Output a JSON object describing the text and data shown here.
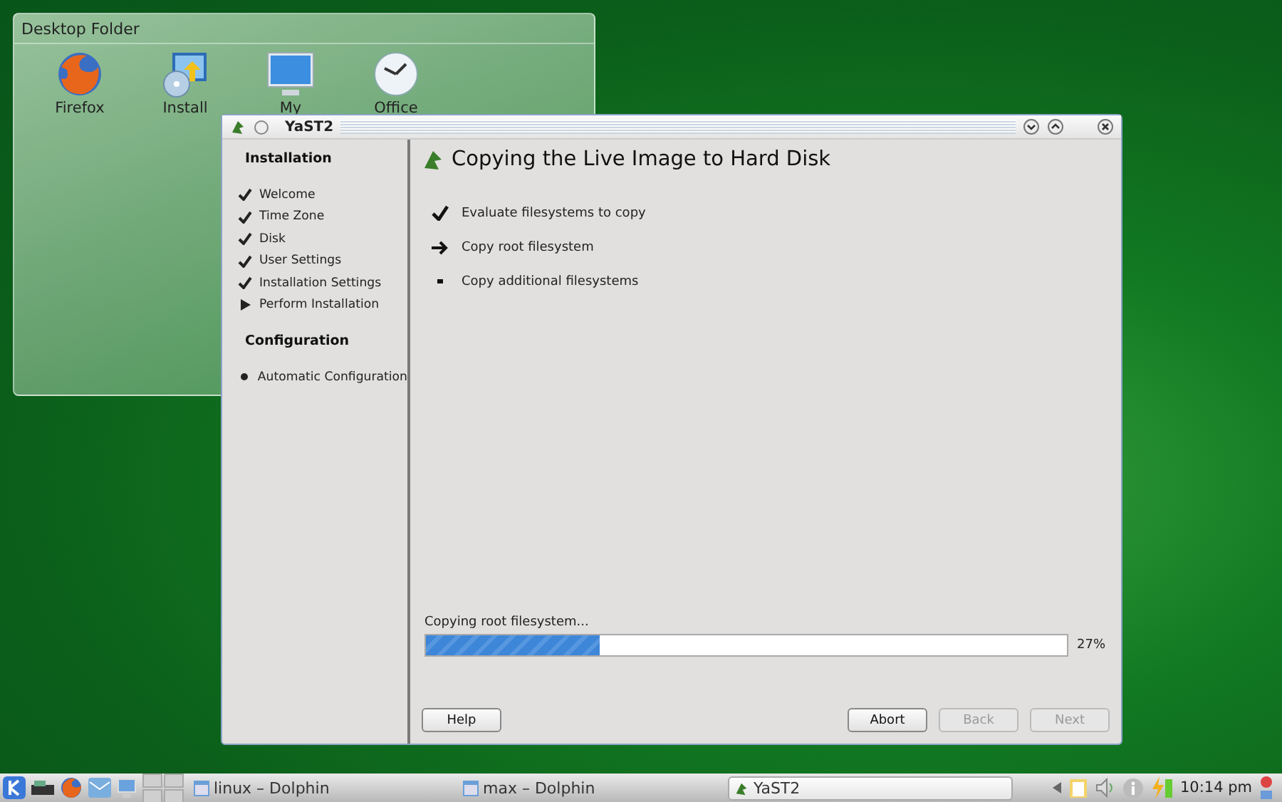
{
  "desktop_folder": {
    "title": "Desktop Folder",
    "icons": [
      {
        "label": "Firefox",
        "kind": "browser"
      },
      {
        "label": "Install",
        "kind": "install"
      },
      {
        "label": "My",
        "kind": "monitor"
      },
      {
        "label": "Office",
        "kind": "clock"
      }
    ]
  },
  "window": {
    "title": "YaST2",
    "sidebar": [
      {
        "heading": "Installation",
        "items": [
          {
            "label": "Welcome",
            "kind": "done"
          },
          {
            "label": "Time Zone",
            "kind": "done"
          },
          {
            "label": "Disk",
            "kind": "done"
          },
          {
            "label": "User Settings",
            "kind": "done"
          },
          {
            "label": "Installation Settings",
            "kind": "done"
          },
          {
            "label": "Perform Installation",
            "kind": "current"
          }
        ]
      },
      {
        "heading": "Configuration",
        "items": [
          {
            "label": "Automatic Configuration",
            "kind": "pending"
          }
        ]
      }
    ],
    "heading": "Copying the Live Image to Hard Disk",
    "steps": [
      {
        "label": "Evaluate filesystems to copy",
        "kind": "done"
      },
      {
        "label": "Copy root filesystem",
        "kind": "current"
      },
      {
        "label": "Copy additional filesystems",
        "kind": "pending"
      }
    ],
    "progress": {
      "label": "Copying root filesystem...",
      "level": 0.27,
      "reading": "27%"
    },
    "left_buttons": [
      {
        "label": "Help",
        "disabled": false
      }
    ],
    "right_buttons": [
      {
        "label": "Abort",
        "disabled": false
      },
      {
        "label": "Back",
        "disabled": true
      },
      {
        "label": "Next",
        "disabled": true
      }
    ]
  },
  "taskbar": {
    "tasks": [
      {
        "label": "linux – Dolphin",
        "kind": "folder",
        "selected": false
      },
      {
        "label": "max – Dolphin",
        "kind": "folder",
        "selected": false
      },
      {
        "label": "YaST2",
        "kind": "yast",
        "selected": true
      }
    ],
    "clock": "10:14 pm"
  }
}
